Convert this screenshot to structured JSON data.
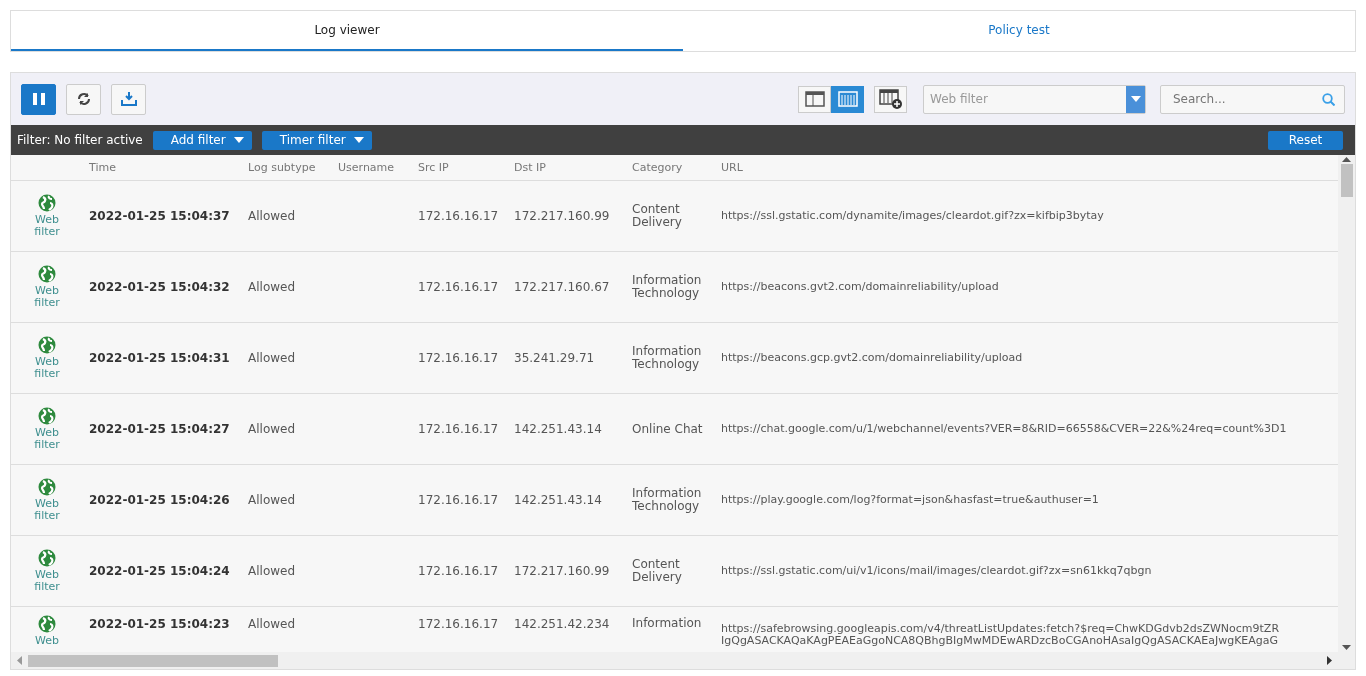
{
  "tabs": [
    {
      "label": "Log viewer",
      "selected": true
    },
    {
      "label": "Policy test",
      "selected": false
    }
  ],
  "toolbar": {
    "paused": true,
    "view_modes": [
      {
        "kind": "detail",
        "selected": false
      },
      {
        "kind": "columns",
        "selected": true
      }
    ],
    "module_select": {
      "value": "Web filter"
    },
    "search": {
      "placeholder": "Search..."
    }
  },
  "filter_bar": {
    "status": "Filter: No filter active",
    "buttons": [
      "Add filter",
      "Timer filter"
    ],
    "reset": "Reset"
  },
  "table": {
    "columns": [
      "",
      "Time",
      "Log subtype",
      "Username",
      "Src IP",
      "Dst IP",
      "Category",
      "URL"
    ],
    "rows": [
      {
        "source": "Web filter",
        "time": "2022-01-25 15:04:37",
        "subtype": "Allowed",
        "username": "",
        "src_ip": "172.16.16.17",
        "dst_ip": "172.217.160.99",
        "category": "Content Delivery",
        "url": [
          "https://ssl.gstatic.com/dynamite/images/cleardot.gif?zx=kifbip3bytay"
        ]
      },
      {
        "source": "Web filter",
        "time": "2022-01-25 15:04:32",
        "subtype": "Allowed",
        "username": "",
        "src_ip": "172.16.16.17",
        "dst_ip": "172.217.160.67",
        "category": "Information Technology",
        "url": [
          "https://beacons.gvt2.com/domainreliability/upload"
        ]
      },
      {
        "source": "Web filter",
        "time": "2022-01-25 15:04:31",
        "subtype": "Allowed",
        "username": "",
        "src_ip": "172.16.16.17",
        "dst_ip": "35.241.29.71",
        "category": "Information Technology",
        "url": [
          "https://beacons.gcp.gvt2.com/domainreliability/upload"
        ]
      },
      {
        "source": "Web filter",
        "time": "2022-01-25 15:04:27",
        "subtype": "Allowed",
        "username": "",
        "src_ip": "172.16.16.17",
        "dst_ip": "142.251.43.14",
        "category": "Online Chat",
        "url": [
          "https://chat.google.com/u/1/webchannel/events?VER=8&RID=66558&CVER=22&%24req=count%3D1"
        ]
      },
      {
        "source": "Web filter",
        "time": "2022-01-25 15:04:26",
        "subtype": "Allowed",
        "username": "",
        "src_ip": "172.16.16.17",
        "dst_ip": "142.251.43.14",
        "category": "Information Technology",
        "url": [
          "https://play.google.com/log?format=json&hasfast=true&authuser=1"
        ]
      },
      {
        "source": "Web filter",
        "time": "2022-01-25 15:04:24",
        "subtype": "Allowed",
        "username": "",
        "src_ip": "172.16.16.17",
        "dst_ip": "172.217.160.99",
        "category": "Content Delivery",
        "url": [
          "https://ssl.gstatic.com/ui/v1/icons/mail/images/cleardot.gif?zx=sn61kkq7qbgn"
        ]
      },
      {
        "source": "Web",
        "time": "2022-01-25 15:04:23",
        "subtype": "Allowed",
        "username": "",
        "src_ip": "172.16.16.17",
        "dst_ip": "142.251.42.234",
        "category": "Information",
        "url": [
          "https://safebrowsing.googleapis.com/v4/threatListUpdates:fetch?$req=ChwKDGdvb2dsZWNocm9tZR",
          "IgQgASACKAQaKAgPEAEaGgoNCA8QBhgBIgMwMDEwARDzcBoCGAnoHAsaIgQgASACKAEaJwgKEAgaG"
        ]
      }
    ]
  }
}
